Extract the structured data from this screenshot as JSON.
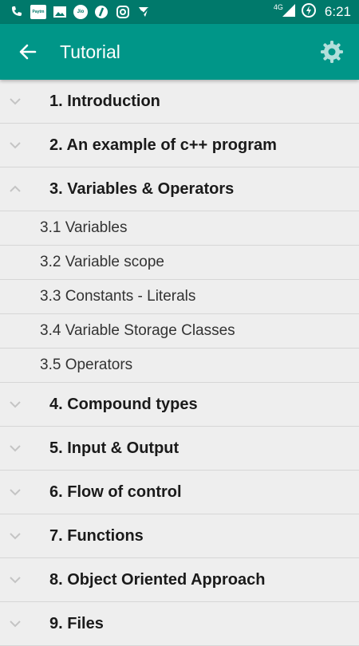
{
  "status_bar": {
    "icons": [
      "call-forward-icon",
      "paytm-icon",
      "image-icon",
      "jio-icon",
      "app-icon",
      "instagram-icon",
      "check-icon"
    ],
    "paytm_text": "Paytm",
    "jio_text": "Jio",
    "network": "4G",
    "time": "6:21"
  },
  "app_bar": {
    "title": "Tutorial"
  },
  "list": {
    "items": [
      {
        "label": "1. Introduction",
        "expanded": false
      },
      {
        "label": "2. An example of c++ program",
        "expanded": false
      },
      {
        "label": "3. Variables & Operators",
        "expanded": true,
        "children": [
          "3.1 Variables",
          "3.2 Variable scope",
          "3.3 Constants - Literals",
          "3.4 Variable Storage Classes",
          "3.5 Operators"
        ]
      },
      {
        "label": "4. Compound types",
        "expanded": false
      },
      {
        "label": "5. Input & Output",
        "expanded": false
      },
      {
        "label": "6. Flow of control",
        "expanded": false
      },
      {
        "label": "7. Functions",
        "expanded": false
      },
      {
        "label": "8. Object Oriented Approach",
        "expanded": false
      },
      {
        "label": "9. Files",
        "expanded": false
      }
    ]
  },
  "colors": {
    "status_bar": "#00796b",
    "app_bar": "#009688",
    "background": "#eeeeee",
    "divider": "#d6d6d6"
  }
}
